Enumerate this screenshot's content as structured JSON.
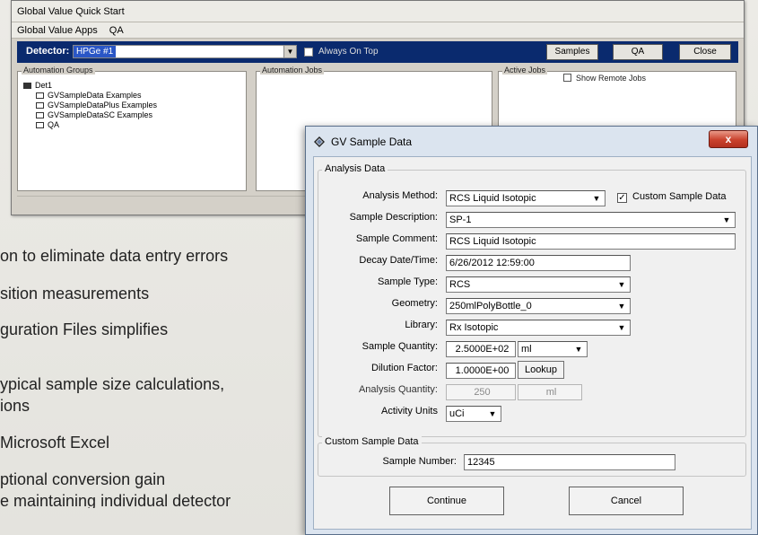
{
  "background_slide": {
    "bullets": [
      "on to eliminate data entry errors",
      "sition measurements",
      "guration Files simplifies",
      "ypical sample size calculations,",
      "ions",
      "Microsoft Excel",
      "ptional conversion gain",
      "e maintaining individual detector"
    ]
  },
  "main_window": {
    "title": "Global Value Quick Start",
    "menu": [
      "Global Value Apps",
      "QA"
    ],
    "detector_label": "Detector:",
    "detector_value": "HPGe #1",
    "always_on_top_label": "Always On Top",
    "buttons": {
      "samples": "Samples",
      "qa": "QA",
      "close": "Close"
    },
    "automation_groups_title": "Automation Groups",
    "automation_jobs_title": "Automation Jobs",
    "active_jobs_title": "Active Jobs",
    "show_remote_jobs_label": "Show Remote Jobs",
    "tree": {
      "root": "Det1",
      "children": [
        "GVSampleData Examples",
        "GVSampleDataPlus Examples",
        "GVSampleDataSC Examples",
        "QA"
      ]
    }
  },
  "dialog": {
    "title": "GV Sample Data",
    "close_glyph": "x",
    "analysis_group": "Analysis Data",
    "analysis_method_label": "Analysis Method:",
    "analysis_method_value": "RCS Liquid Isotopic",
    "custom_sample_data_checkbox_label": "Custom Sample Data",
    "custom_sample_data_checked": true,
    "sample_description_label": "Sample Description:",
    "sample_description_value": "SP-1",
    "sample_comment_label": "Sample Comment:",
    "sample_comment_value": "RCS Liquid Isotopic",
    "decay_label": "Decay Date/Time:",
    "decay_value": "6/26/2012 12:59:00",
    "sample_type_label": "Sample Type:",
    "sample_type_value": "RCS",
    "geometry_label": "Geometry:",
    "geometry_value": "250mlPolyBottle_0",
    "library_label": "Library:",
    "library_value": "Rx Isotopic",
    "sample_quantity_label": "Sample Quantity:",
    "sample_quantity_value": "2.5000E+02",
    "sample_quantity_unit": "ml",
    "dilution_label": "Dilution Factor:",
    "dilution_value": "1.0000E+00",
    "lookup_label": "Lookup",
    "analysis_quantity_label": "Analysis Quantity:",
    "analysis_quantity_value": "250",
    "analysis_quantity_unit": "ml",
    "activity_units_label": "Activity Units",
    "activity_units_value": "uCi",
    "custom_group": "Custom Sample Data",
    "sample_number_label": "Sample Number:",
    "sample_number_value": "12345",
    "continue_label": "Continue",
    "cancel_label": "Cancel"
  }
}
